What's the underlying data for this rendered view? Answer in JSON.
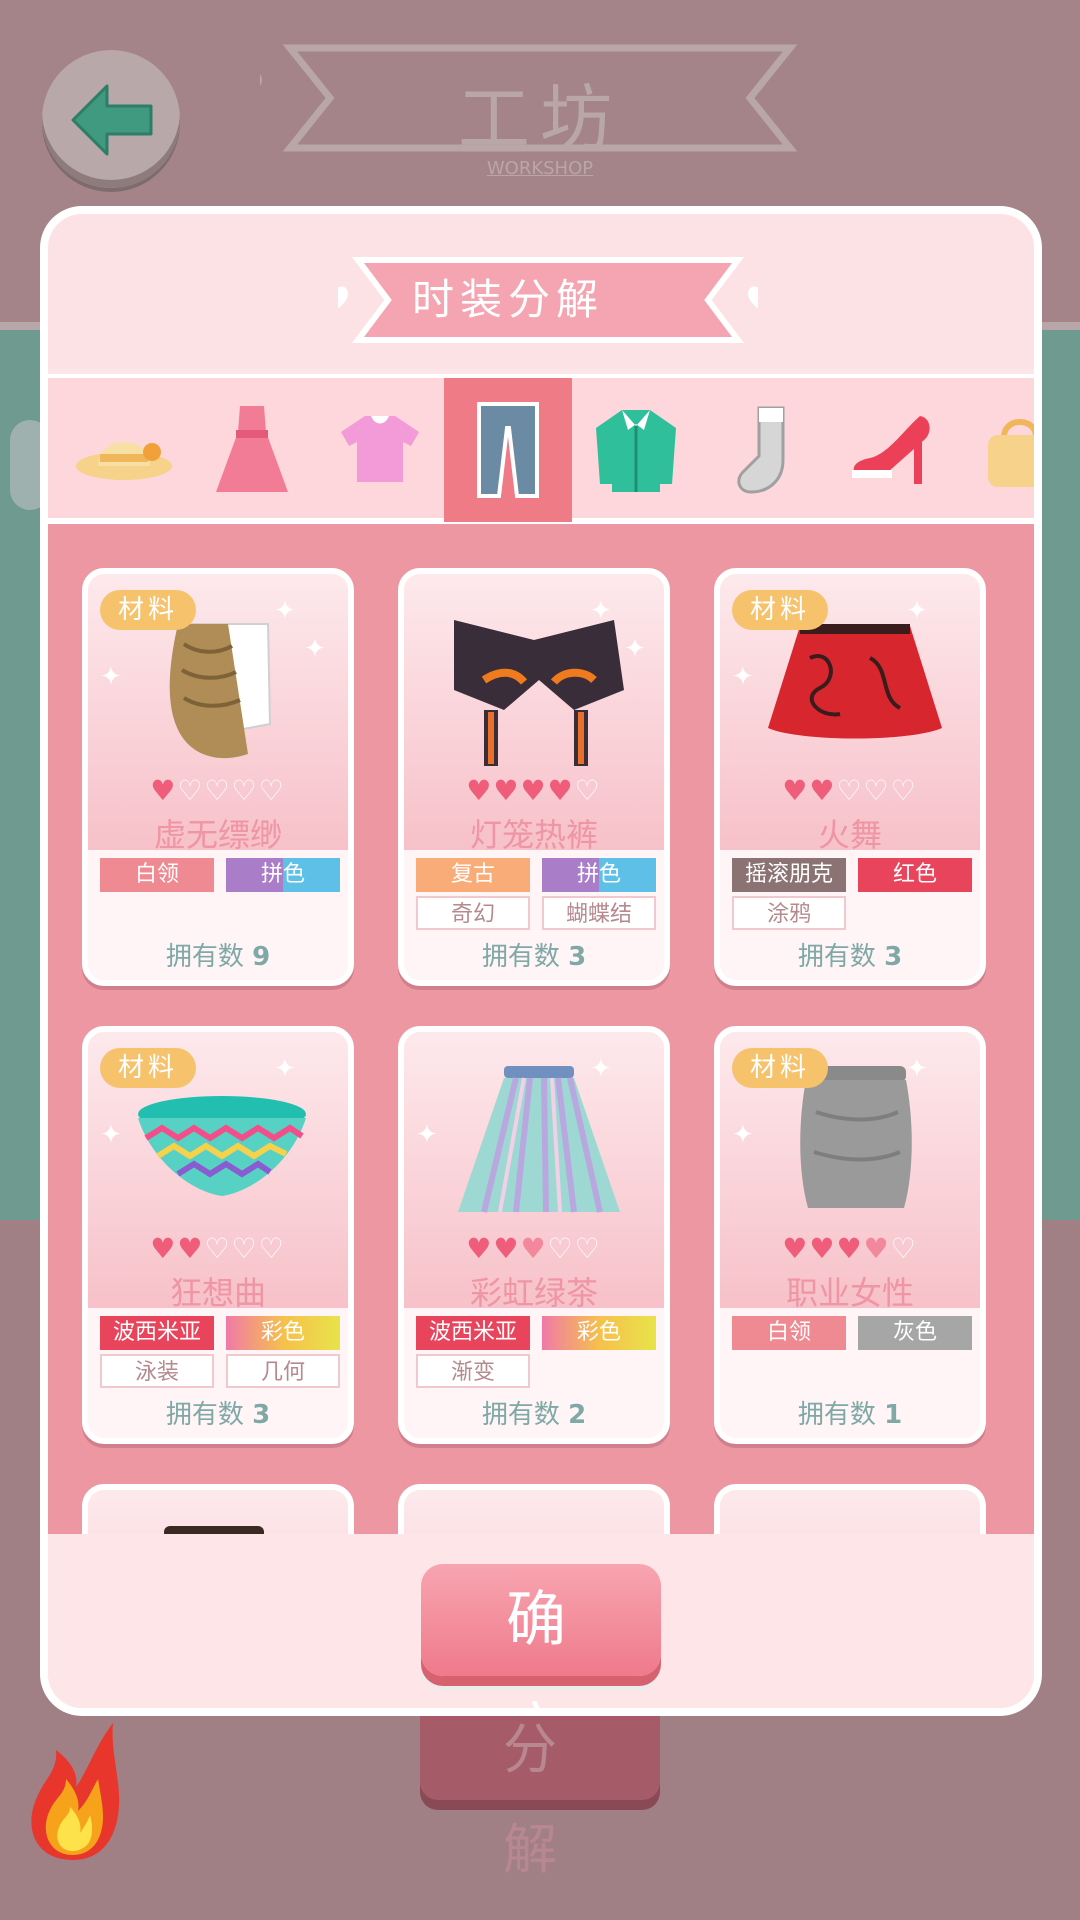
{
  "header": {
    "title": "工坊",
    "subtitle": "WORKSHOP"
  },
  "background": {
    "decompose_label": "分 解"
  },
  "modal": {
    "title": "时装分解",
    "confirm_label": "确 定",
    "tabs": [
      {
        "icon": "hat-icon",
        "active": false
      },
      {
        "icon": "dress-icon",
        "active": false
      },
      {
        "icon": "top-icon",
        "active": false
      },
      {
        "icon": "pants-icon",
        "active": true
      },
      {
        "icon": "coat-icon",
        "active": false
      },
      {
        "icon": "sock-icon",
        "active": false
      },
      {
        "icon": "high-heel-icon",
        "active": false
      },
      {
        "icon": "bag-icon",
        "active": false
      }
    ],
    "items": [
      {
        "name": "虚无缥缈",
        "material": "材料",
        "stars": 1,
        "max_stars": 5,
        "tags": [
          "白领",
          "拼色"
        ],
        "owned_label": "拥有数",
        "owned": "9"
      },
      {
        "name": "灯笼热裤",
        "material": "",
        "stars": 4,
        "max_stars": 5,
        "tags": [
          "复古",
          "拼色",
          "奇幻",
          "蝴蝶结"
        ],
        "owned_label": "拥有数",
        "owned": "3"
      },
      {
        "name": "火舞",
        "material": "材料",
        "stars": 2,
        "max_stars": 5,
        "tags": [
          "摇滚朋克",
          "红色",
          "涂鸦"
        ],
        "owned_label": "拥有数",
        "owned": "3"
      },
      {
        "name": "狂想曲",
        "material": "材料",
        "stars": 2,
        "max_stars": 5,
        "tags": [
          "波西米亚",
          "彩色",
          "泳装",
          "几何"
        ],
        "owned_label": "拥有数",
        "owned": "3"
      },
      {
        "name": "彩虹绿茶",
        "material": "",
        "stars": 2.5,
        "max_stars": 5,
        "tags": [
          "波西米亚",
          "彩色",
          "渐变"
        ],
        "owned_label": "拥有数",
        "owned": "2"
      },
      {
        "name": "职业女性",
        "material": "材料",
        "stars": 3.5,
        "max_stars": 5,
        "tags": [
          "白领",
          "灰色"
        ],
        "owned_label": "拥有数",
        "owned": "1"
      }
    ]
  },
  "colors": {
    "accent_pink": "#ee7b86",
    "badge_orange": "#f6c26c",
    "owned_teal": "#7fa8a6",
    "tag_white_collar": "#ef8a92",
    "tag_patchwork": "linear-gradient(90deg,#a97dc7 50%,#5ec0e6 50%)",
    "tag_retro": "#f9ab78",
    "tag_rock": "#8b7374",
    "tag_red": "#e8445c",
    "tag_bohemian": "#e8445c",
    "tag_colorful": "linear-gradient(90deg,#f07aa8,#f6c04c,#e8e34a)",
    "tag_grey": "#a6a6a6"
  }
}
